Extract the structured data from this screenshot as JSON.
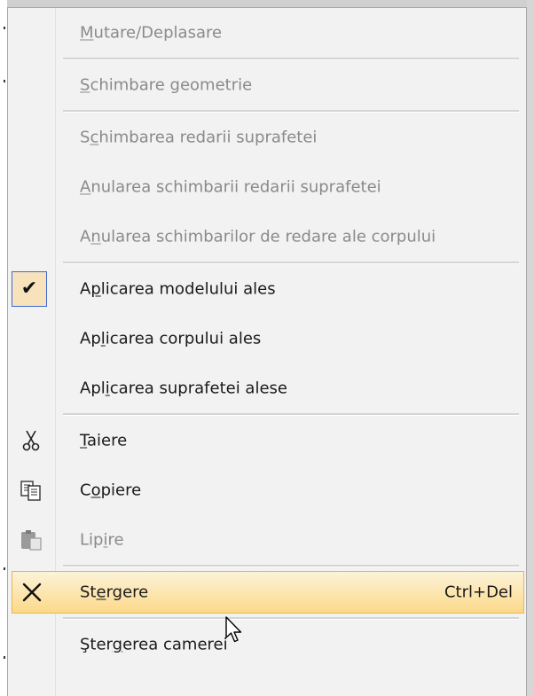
{
  "menu": {
    "items": [
      {
        "id": "mutare",
        "pre": "",
        "u": "M",
        "post": "utare/Deplasare",
        "disabled": true,
        "icon": ""
      },
      {
        "sep": true
      },
      {
        "id": "geometrie",
        "pre": "",
        "u": "S",
        "post": "chimbare geometrie",
        "disabled": true,
        "icon": ""
      },
      {
        "sep": true
      },
      {
        "id": "redare",
        "pre": "S",
        "u": "c",
        "post": "himbarea redarii suprafetei",
        "disabled": true,
        "icon": ""
      },
      {
        "id": "anulare-suprafata",
        "pre": "",
        "u": "A",
        "post": "nularea schimbarii redarii suprafetei",
        "disabled": true,
        "icon": ""
      },
      {
        "id": "anulare-corp",
        "pre": "A",
        "u": "n",
        "post": "ularea schimbarilor de redare ale corpului",
        "disabled": true,
        "icon": ""
      },
      {
        "sep": true
      },
      {
        "id": "aplicare-model",
        "pre": "A",
        "u": "p",
        "post": "licarea modelului ales",
        "disabled": false,
        "icon": "check-icon",
        "checked": true
      },
      {
        "id": "aplicare-corp",
        "pre": "Ap",
        "u": "l",
        "post": "icarea corpului ales",
        "disabled": false,
        "icon": ""
      },
      {
        "id": "aplicare-suprafata",
        "pre": "Apl",
        "u": "i",
        "post": "carea suprafetei alese",
        "disabled": false,
        "icon": ""
      },
      {
        "sep": true
      },
      {
        "id": "taiere",
        "pre": "",
        "u": "T",
        "post": "aiere",
        "disabled": false,
        "icon": "scissors-icon"
      },
      {
        "id": "copiere",
        "pre": "C",
        "u": "o",
        "post": "piere",
        "disabled": false,
        "icon": "copy-icon"
      },
      {
        "id": "lipire",
        "pre": "Lip",
        "u": "i",
        "post": "re",
        "disabled": true,
        "icon": "paste-icon"
      },
      {
        "sep": true
      },
      {
        "id": "stergere",
        "pre": "St",
        "u": "e",
        "post": "rgere",
        "disabled": false,
        "icon": "delete-x-icon",
        "hover": true,
        "shortcut": "Ctrl+Del"
      },
      {
        "sep": true
      },
      {
        "id": "stergere-camera",
        "pre": "Şter",
        "u": "g",
        "post": "erea camerei",
        "disabled": false,
        "icon": ""
      }
    ]
  },
  "colors": {
    "hover_top": "#fdf3d8",
    "hover_bottom": "#fbd98a",
    "hover_border": "#e8b64a",
    "check_bg": "#f8e2bc",
    "check_border": "#3c6ad1",
    "disabled_text": "#8a8a8a"
  }
}
